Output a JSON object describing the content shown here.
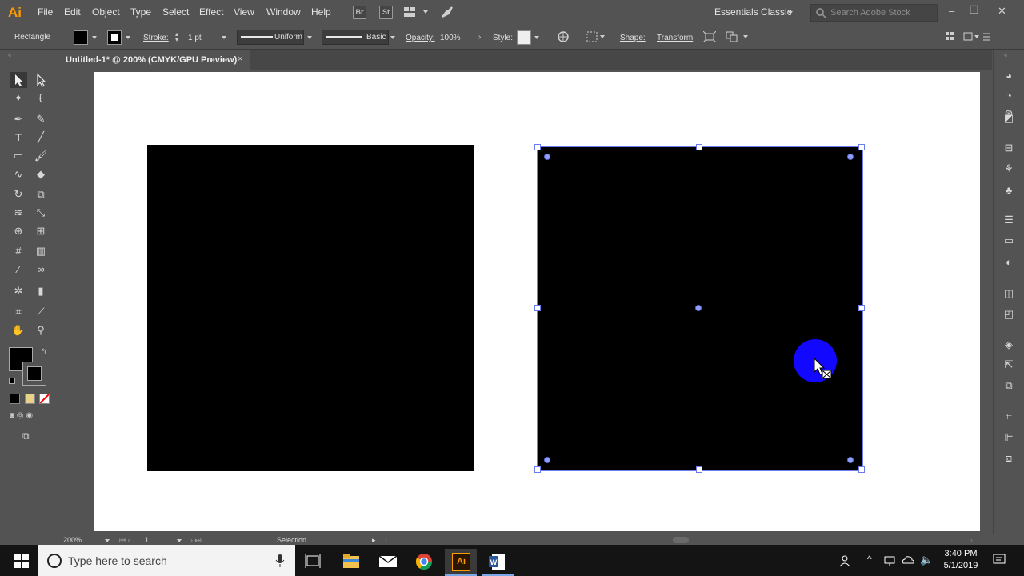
{
  "app": {
    "logo": "Ai"
  },
  "menu": [
    "File",
    "Edit",
    "Object",
    "Type",
    "Select",
    "Effect",
    "View",
    "Window",
    "Help"
  ],
  "menubar_icons": {
    "bridge": "Br",
    "stock": "St"
  },
  "workspace": "Essentials Classic",
  "search_stock": {
    "placeholder": "Search Adobe Stock"
  },
  "control": {
    "tool_name": "Rectangle",
    "stroke_label": "Stroke:",
    "stroke_weight": "1 pt",
    "profile_uniform": "Uniform",
    "brush_basic": "Basic",
    "opacity_label": "Opacity:",
    "opacity_value": "100%",
    "style_label": "Style:",
    "shape_label": "Shape:",
    "transform_label": "Transform"
  },
  "document_tab": {
    "title": "Untitled-1* @ 200% (CMYK/GPU Preview)",
    "close": "×"
  },
  "status": {
    "zoom": "200%",
    "artboard": "1",
    "tool": "Selection"
  },
  "taskbar": {
    "search_placeholder": "Type here to search",
    "time": "3:40 PM",
    "date": "5/1/2019",
    "illustrator_label": "Ai"
  },
  "colors": {
    "fill": "#000000",
    "selection_outline": "#6b7cf0",
    "cursor_halo": "#1207ff",
    "ai_orange": "#ff9a00"
  }
}
